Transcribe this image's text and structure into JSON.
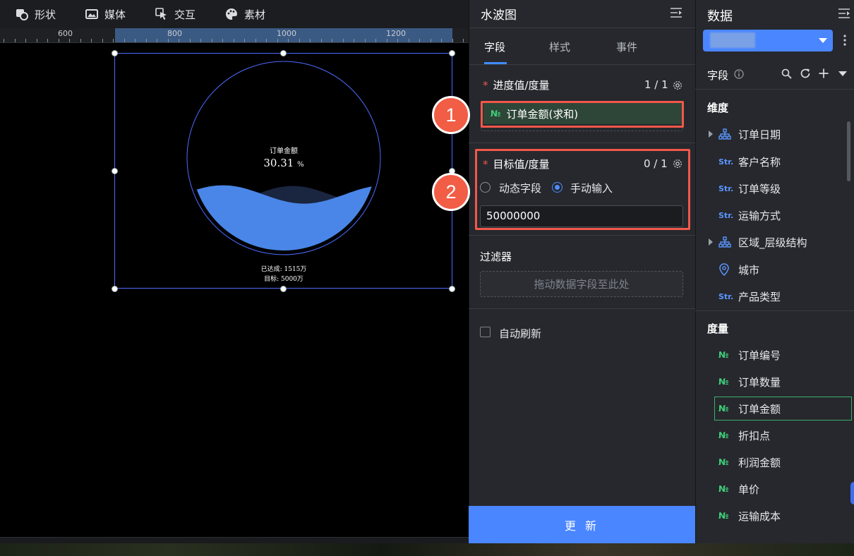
{
  "toolbar": {
    "items": [
      {
        "label": "形状",
        "icon": "shape-icon"
      },
      {
        "label": "媒体",
        "icon": "image-icon"
      },
      {
        "label": "交互",
        "icon": "pointer-icon"
      },
      {
        "label": "素材",
        "icon": "palette-icon"
      }
    ]
  },
  "ruler": {
    "labels": [
      "600",
      "800",
      "1000",
      "1200"
    ]
  },
  "widget": {
    "title": "订单金额",
    "percent": "30.31",
    "percent_unit": "%",
    "progress_fraction": 0.3031,
    "achieved": "已达成: 1515万",
    "target": "目标: 5000万",
    "colors": {
      "wave_front": "#4a86e8",
      "wave_back": "#1a2540",
      "ring": "#4d6bfe"
    }
  },
  "panel": {
    "title": "水波图",
    "tabs": [
      "字段",
      "样式",
      "事件"
    ],
    "active_tab": "字段",
    "progress": {
      "label": "进度值/度量",
      "count": "1 / 1",
      "field_type": "№",
      "field_label": "订单金额(求和)",
      "badge": "1"
    },
    "target": {
      "label": "目标值/度量",
      "count": "0 / 1",
      "option_dynamic": "动态字段",
      "option_manual": "手动输入",
      "selected": "手动输入",
      "value": "50000000",
      "badge": "2"
    },
    "filter": {
      "label": "过滤器",
      "placeholder": "拖动数据字段至此处"
    },
    "auto_refresh": {
      "label": "自动刷新",
      "checked": false
    },
    "update_button": "更 新"
  },
  "data_panel": {
    "title": "数据",
    "fields_label": "字段",
    "dimensions_label": "维度",
    "dimensions": [
      {
        "label": "订单日期",
        "type": "hierarchy",
        "expandable": true
      },
      {
        "label": "客户名称",
        "type": "Str."
      },
      {
        "label": "订单等级",
        "type": "Str."
      },
      {
        "label": "运输方式",
        "type": "Str."
      },
      {
        "label": "区域_层级结构",
        "type": "hierarchy",
        "expandable": true
      },
      {
        "label": "城市",
        "type": "geo"
      },
      {
        "label": "产品类型",
        "type": "Str."
      }
    ],
    "measures_label": "度量",
    "measures": [
      {
        "label": "订单编号",
        "type": "№"
      },
      {
        "label": "订单数量",
        "type": "№"
      },
      {
        "label": "订单金额",
        "type": "№",
        "selected": true
      },
      {
        "label": "折扣点",
        "type": "№"
      },
      {
        "label": "利润金额",
        "type": "№"
      },
      {
        "label": "单价",
        "type": "№"
      },
      {
        "label": "运输成本",
        "type": "№"
      }
    ]
  }
}
